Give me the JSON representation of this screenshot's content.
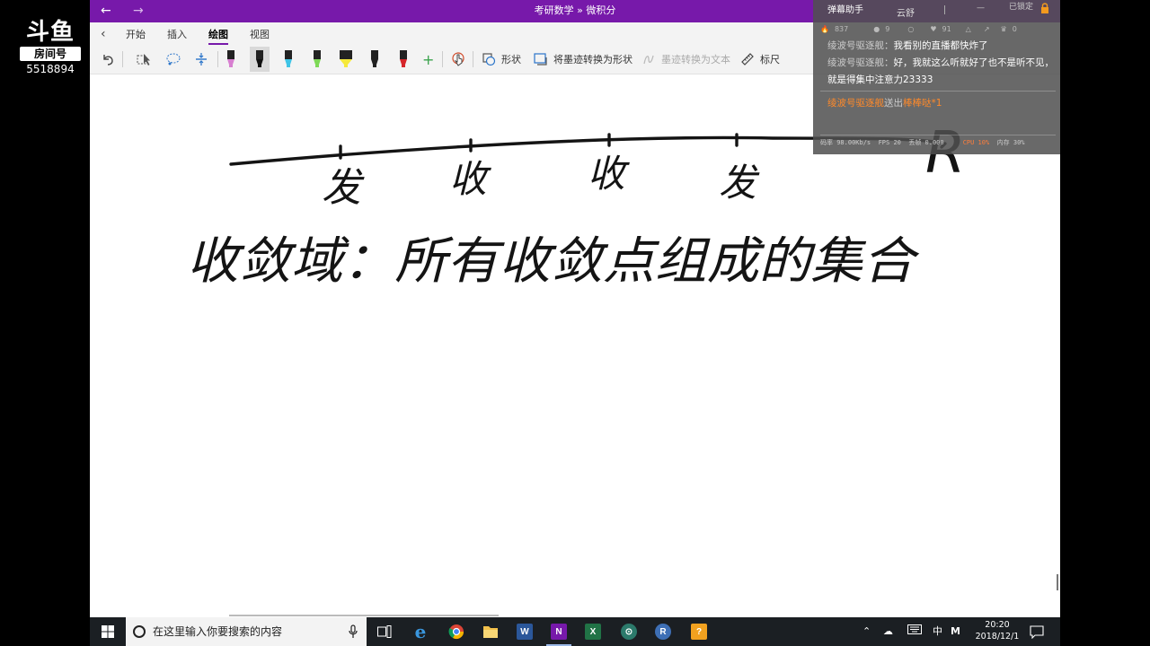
{
  "watermark": {
    "logo": "斗鱼",
    "room_label": "房间号",
    "room_number": "5518894"
  },
  "window": {
    "title": "考研数学 » 微积分",
    "back": "←",
    "forward": "→"
  },
  "ribbon": {
    "tabs": [
      {
        "label": "开始"
      },
      {
        "label": "插入"
      },
      {
        "label": "绘图"
      },
      {
        "label": "视图"
      }
    ],
    "active_tab": "绘图",
    "tools": {
      "shapes": "形状",
      "ink_to_shape": "将墨迹转换为形状",
      "ink_to_text": "墨迹转换为文本",
      "ruler": "标尺",
      "add_pen": "+"
    },
    "pen_colors": [
      "#d77fd0",
      "#111111",
      "#3fc4e6",
      "#7ed957",
      "#f5e93b",
      "#222222",
      "#d6262b"
    ]
  },
  "canvas": {
    "line_ticks": [
      "发",
      "收",
      "收",
      "发"
    ],
    "line_end_label": "R",
    "sentence": "收敛域：所有收敛点组成的集合"
  },
  "danmu": {
    "header": {
      "title": "弹幕助手",
      "cloud": "云舒",
      "lock": "已锁定"
    },
    "stats": [
      "837",
      "9",
      "91",
      "0"
    ],
    "messages": [
      {
        "user": "绫波号驱逐舰",
        "text": "我看别的直播都快炸了"
      },
      {
        "user": "绫波号驱逐舰",
        "text": "好，我就这么听就好了也不是听不见，就是得集中注意力23333"
      }
    ],
    "gift": {
      "user": "绫波号驱逐舰",
      "action": "送出",
      "item": "棒棒哒*1"
    },
    "perf": {
      "bitrate": "码率 98.00Kb/s",
      "fps": "FPS 20",
      "dropped": "丢帧 0.000",
      "cpu": "CPU 10%",
      "mem": "内存 30%"
    }
  },
  "taskbar": {
    "search_placeholder": "在这里输入你要搜索的内容",
    "apps": [
      "task-view",
      "edge",
      "chrome",
      "explorer",
      "word",
      "onenote",
      "excel",
      "app-generic",
      "app-r",
      "app-game"
    ],
    "tray": {
      "ime": "中",
      "ime2": "M"
    },
    "clock": {
      "time": "20:20",
      "date": "2018/12/1"
    }
  }
}
